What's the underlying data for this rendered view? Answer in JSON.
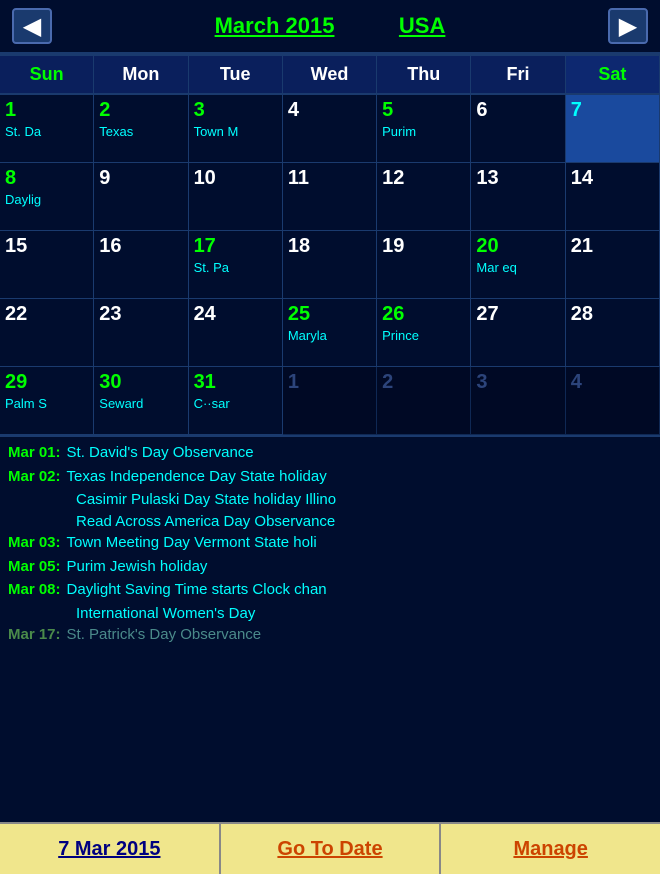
{
  "header": {
    "month": "March 2015",
    "country": "USA",
    "prev_label": "◀",
    "next_label": "▶"
  },
  "day_headers": [
    {
      "label": "Sun",
      "class": "sun"
    },
    {
      "label": "Mon",
      "class": ""
    },
    {
      "label": "Tue",
      "class": ""
    },
    {
      "label": "Wed",
      "class": ""
    },
    {
      "label": "Thu",
      "class": ""
    },
    {
      "label": "Fri",
      "class": ""
    },
    {
      "label": "Sat",
      "class": "sat"
    }
  ],
  "weeks": [
    [
      {
        "num": "1",
        "event": "St. Da",
        "color": "green",
        "type": "normal"
      },
      {
        "num": "2",
        "event": "Texas",
        "color": "green",
        "type": "normal"
      },
      {
        "num": "3",
        "event": "Town M",
        "color": "green",
        "type": "normal"
      },
      {
        "num": "4",
        "event": "",
        "color": "white",
        "type": "normal"
      },
      {
        "num": "5",
        "event": "Purim",
        "color": "green",
        "type": "normal"
      },
      {
        "num": "6",
        "event": "",
        "color": "white",
        "type": "normal"
      },
      {
        "num": "7",
        "event": "",
        "color": "cyan",
        "type": "today"
      }
    ],
    [
      {
        "num": "8",
        "event": "Daylig",
        "color": "green",
        "type": "normal"
      },
      {
        "num": "9",
        "event": "",
        "color": "white",
        "type": "normal"
      },
      {
        "num": "10",
        "event": "",
        "color": "white",
        "type": "normal"
      },
      {
        "num": "11",
        "event": "",
        "color": "white",
        "type": "normal"
      },
      {
        "num": "12",
        "event": "",
        "color": "white",
        "type": "normal"
      },
      {
        "num": "13",
        "event": "",
        "color": "white",
        "type": "normal"
      },
      {
        "num": "14",
        "event": "",
        "color": "white",
        "type": "normal"
      }
    ],
    [
      {
        "num": "15",
        "event": "",
        "color": "white",
        "type": "normal"
      },
      {
        "num": "16",
        "event": "",
        "color": "white",
        "type": "normal"
      },
      {
        "num": "17",
        "event": "St. Pa",
        "color": "green",
        "type": "normal"
      },
      {
        "num": "18",
        "event": "",
        "color": "white",
        "type": "normal"
      },
      {
        "num": "19",
        "event": "",
        "color": "white",
        "type": "normal"
      },
      {
        "num": "20",
        "event": "Mar eq",
        "color": "green",
        "type": "normal"
      },
      {
        "num": "21",
        "event": "",
        "color": "white",
        "type": "normal"
      }
    ],
    [
      {
        "num": "22",
        "event": "",
        "color": "white",
        "type": "normal"
      },
      {
        "num": "23",
        "event": "",
        "color": "white",
        "type": "normal"
      },
      {
        "num": "24",
        "event": "",
        "color": "white",
        "type": "normal"
      },
      {
        "num": "25",
        "event": "Maryla",
        "color": "green",
        "type": "normal"
      },
      {
        "num": "26",
        "event": "Prince",
        "color": "green",
        "type": "normal"
      },
      {
        "num": "27",
        "event": "",
        "color": "white",
        "type": "normal"
      },
      {
        "num": "28",
        "event": "",
        "color": "white",
        "type": "normal"
      }
    ],
    [
      {
        "num": "29",
        "event": "Palm S",
        "color": "green",
        "type": "normal"
      },
      {
        "num": "30",
        "event": "Seward",
        "color": "green",
        "type": "normal"
      },
      {
        "num": "31",
        "event": "C··sar",
        "color": "green",
        "type": "normal"
      },
      {
        "num": "1",
        "event": "",
        "color": "empty",
        "type": "empty"
      },
      {
        "num": "2",
        "event": "",
        "color": "empty",
        "type": "empty"
      },
      {
        "num": "3",
        "event": "",
        "color": "empty",
        "type": "empty"
      },
      {
        "num": "4",
        "event": "",
        "color": "empty",
        "type": "empty"
      }
    ]
  ],
  "events": [
    {
      "date": "Mar 01:",
      "text": "St. David's Day Observance"
    },
    {
      "date": "Mar 02:",
      "text": "Texas Independence Day State holiday"
    },
    {
      "date": "",
      "text": "Casimir Pulaski Day State holiday Illino"
    },
    {
      "date": "",
      "text": "Read Across America Day Observance"
    },
    {
      "date": "Mar 03:",
      "text": "Town Meeting Day Vermont State holi"
    },
    {
      "date": "Mar 05:",
      "text": "Purim Jewish holiday"
    },
    {
      "date": "Mar 08:",
      "text": "Daylight Saving Time starts Clock chan"
    },
    {
      "date": "",
      "text": "International Women's Day"
    },
    {
      "date": "Mar 17:",
      "text": "St. Patrick's Day Observance"
    }
  ],
  "footer": {
    "date_label": "7 Mar 2015",
    "goto_label": "Go To Date",
    "manage_label": "Manage"
  }
}
